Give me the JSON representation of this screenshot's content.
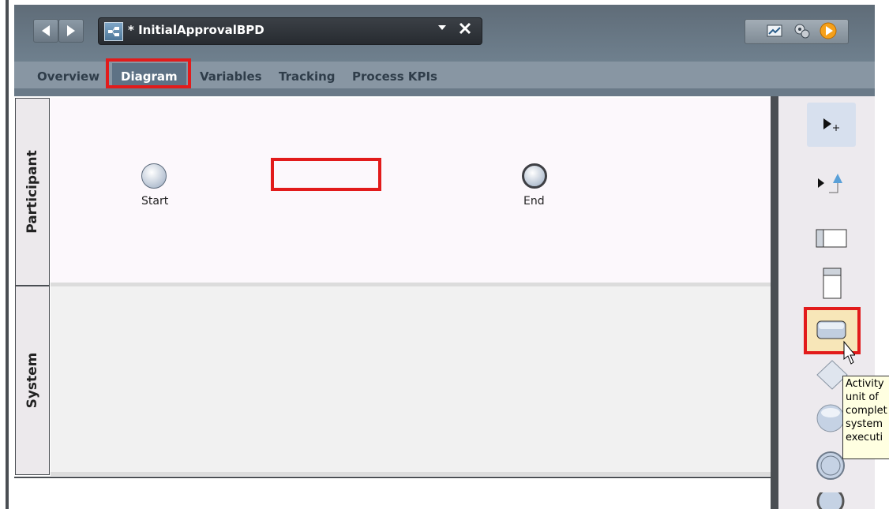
{
  "window": {
    "document_title": "* InitialApprovalBPD"
  },
  "subtabs": [
    {
      "label": "Overview"
    },
    {
      "label": "Diagram"
    },
    {
      "label": "Variables"
    },
    {
      "label": "Tracking"
    },
    {
      "label": "Process KPIs"
    }
  ],
  "lanes": [
    {
      "label": "Participant"
    },
    {
      "label": "System"
    }
  ],
  "events": {
    "start_label": "Start",
    "end_label": "End"
  },
  "tooltip": {
    "lines": [
      "Activity",
      "unit of",
      "complet",
      "system",
      "executi"
    ]
  },
  "colors": {
    "highlight": "#e21b1b",
    "tooltip_bg": "#ffffe1"
  },
  "icons": [
    "back-icon",
    "forward-icon",
    "bpd-icon",
    "dropdown-icon",
    "close-icon",
    "chart-icon",
    "settings-icon",
    "run-icon",
    "select-tool-icon",
    "sequence-flow-icon",
    "lane-icon",
    "horizontal-lane-icon",
    "activity-icon",
    "gateway-icon",
    "start-event-icon",
    "intermediate-event-icon",
    "end-event-icon",
    "cursor-icon"
  ]
}
